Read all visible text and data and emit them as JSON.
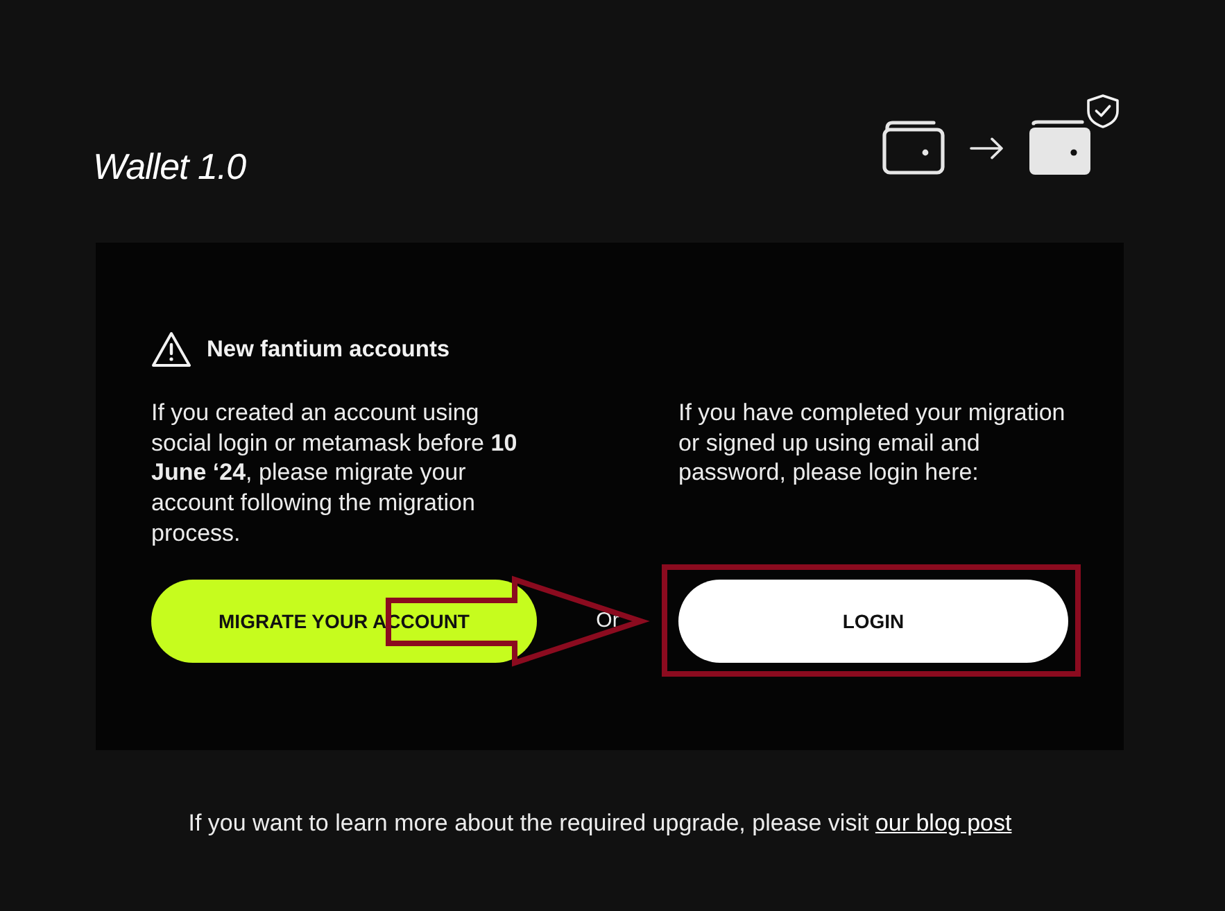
{
  "header": {
    "title": "Wallet 1.0"
  },
  "notice": {
    "heading": "New fantium accounts",
    "text": "If you created an account using social login or metamask before **10 June ‘24**, please migrate your account following the migration process."
  },
  "migrate_button": {
    "label": "MIGRATE YOUR ACCOUNT"
  },
  "separator": "Or",
  "login": {
    "text": "If you have completed your migration or signed up using email and password, please login here:",
    "button": {
      "label": "LOGIN"
    }
  },
  "footer": {
    "text": "If you want to learn more about the required upgrade, please visit",
    "link": "our blog post"
  }
}
